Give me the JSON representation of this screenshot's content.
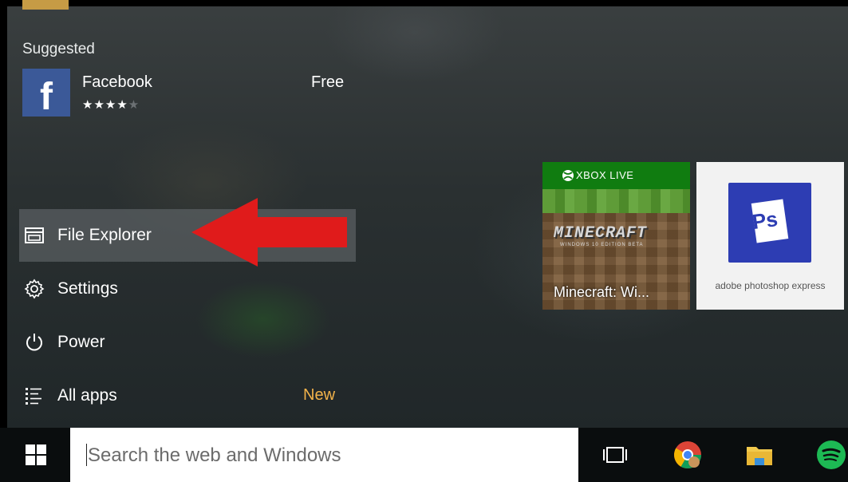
{
  "suggested": {
    "header": "Suggested",
    "app": {
      "name": "Facebook",
      "price": "Free",
      "rating_stars": 3.5,
      "rating_max": 5,
      "tile_letter": "f",
      "tile_color": "#3b5998"
    }
  },
  "menu": {
    "file_explorer": "File Explorer",
    "settings": "Settings",
    "power": "Power",
    "all_apps": "All apps",
    "all_apps_badge": "New"
  },
  "tiles": {
    "minecraft": {
      "banner": "XBOX LIVE",
      "logo": "MINECRAFT",
      "logo_sub": "WINDOWS 10 EDITION BETA",
      "label": "Minecraft: Wi..."
    },
    "photoshop": {
      "icon_text": "Ps",
      "label": "adobe photoshop express"
    }
  },
  "taskbar": {
    "search_placeholder": "Search the web and Windows"
  },
  "colors": {
    "annotation_arrow": "#e01b1b",
    "new_badge": "#f2b24a",
    "xbox_green": "#107c10",
    "photoshop_blue": "#2d3db3"
  },
  "icons": [
    "windows-logo-icon",
    "file-explorer-icon",
    "gear-icon",
    "power-icon",
    "list-icon",
    "chevron-right-icon",
    "xbox-icon",
    "task-view-icon",
    "chrome-icon",
    "folder-icon",
    "spotify-icon"
  ]
}
